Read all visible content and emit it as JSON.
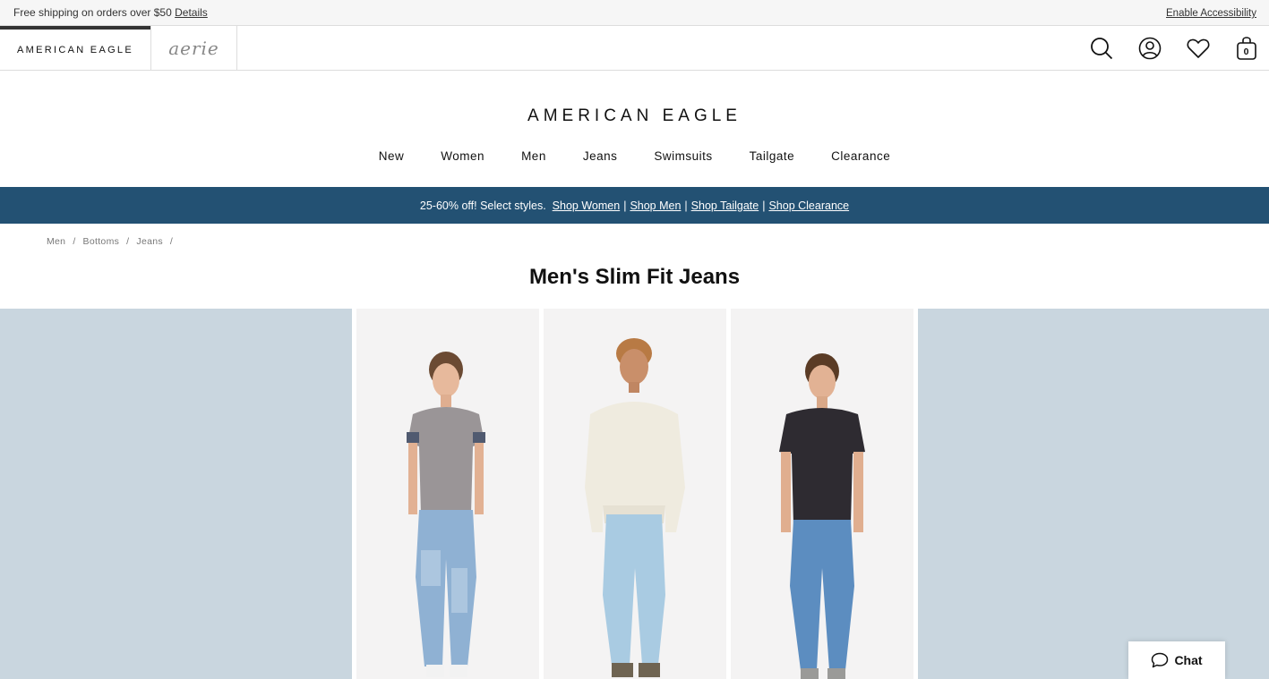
{
  "topbar": {
    "shipping_text": "Free shipping on orders over $50",
    "details_link": "Details",
    "accessibility_link": "Enable Accessibility"
  },
  "brands": {
    "ae_tab": "AMERICAN EAGLE",
    "aerie_tab": "aerie"
  },
  "header_icons": [
    "search-icon",
    "account-icon",
    "heart-icon",
    "bag-icon"
  ],
  "cart": {
    "count": "0"
  },
  "logo": "AMERICAN EAGLE",
  "nav": {
    "items": [
      "New",
      "Women",
      "Men",
      "Jeans",
      "Swimsuits",
      "Tailgate",
      "Clearance"
    ]
  },
  "promo": {
    "text": "25-60% off! Select styles.",
    "links": [
      "Shop Women",
      "Shop Men",
      "Shop Tailgate",
      "Shop Clearance"
    ],
    "separator": "|",
    "bg_color": "#235173"
  },
  "breadcrumb": {
    "items": [
      "Men",
      "Bottoms",
      "Jeans"
    ],
    "separator": "/"
  },
  "page_title": "Men's Slim Fit Jeans",
  "colors": {
    "gallery_side_bg": "#c9d6df",
    "card_bg": "#f3f2f2"
  },
  "chat": {
    "label": "Chat"
  }
}
